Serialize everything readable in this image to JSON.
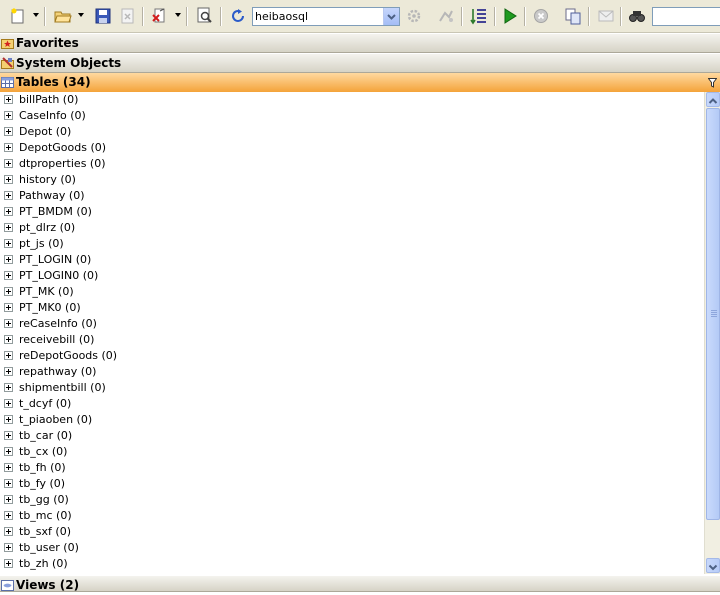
{
  "toolbar": {
    "database": "heibaosql",
    "search_value": ""
  },
  "sections": {
    "favorites": "Favorites",
    "system_objects": "System Objects",
    "tables": "Tables (34)",
    "views": "Views (2)"
  },
  "tables": [
    "billPath (0)",
    "CaseInfo (0)",
    "Depot (0)",
    "DepotGoods (0)",
    "dtproperties (0)",
    "history (0)",
    "Pathway (0)",
    "PT_BMDM (0)",
    "pt_dlrz (0)",
    "pt_js (0)",
    "PT_LOGIN (0)",
    "PT_LOGIN0 (0)",
    "PT_MK (0)",
    "PT_MK0 (0)",
    "reCaseInfo (0)",
    "receivebill (0)",
    "reDepotGoods (0)",
    "repathway (0)",
    "shipmentbill (0)",
    "t_dcyf (0)",
    "t_piaoben (0)",
    "tb_car (0)",
    "tb_cx (0)",
    "tb_fh (0)",
    "tb_fy (0)",
    "tb_gg (0)",
    "tb_mc (0)",
    "tb_sxf (0)",
    "tb_user (0)",
    "tb_zh (0)"
  ],
  "colors": {
    "tables_header": "#f4a33a",
    "section_header": "#d6d3c6",
    "scrollbar": "#b6cbf7"
  },
  "icons": [
    "new-query-icon",
    "open-icon",
    "save-icon",
    "close-doc-icon",
    "debug-icon",
    "preview-icon",
    "refresh-icon",
    "execute-icon",
    "stop-icon",
    "find-icon"
  ]
}
